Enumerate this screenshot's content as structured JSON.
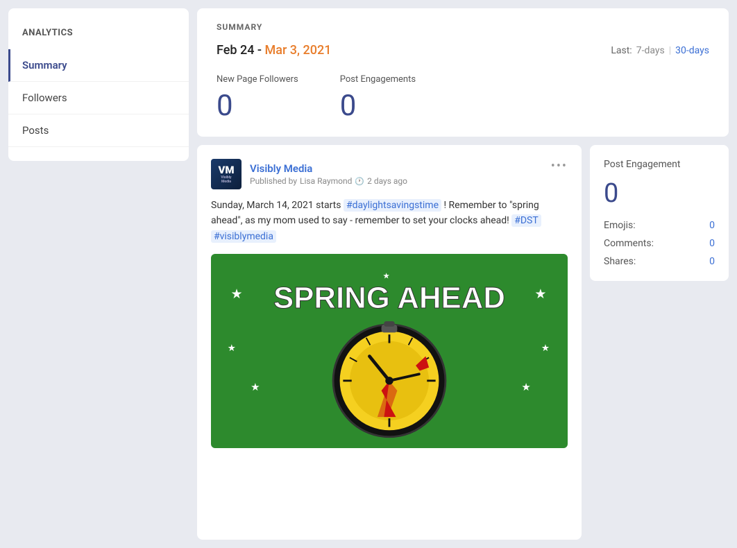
{
  "sidebar": {
    "title": "ANALYTICS",
    "items": [
      {
        "id": "summary",
        "label": "Summary",
        "active": true
      },
      {
        "id": "followers",
        "label": "Followers",
        "active": false
      },
      {
        "id": "posts",
        "label": "Posts",
        "active": false
      }
    ]
  },
  "summary": {
    "section_label": "SUMMARY",
    "date_range_start": "Feb 24 - ",
    "date_range_end": "Mar 3, 2021",
    "last_label": "Last:",
    "period_7": "7-days",
    "period_separator": "|",
    "period_30": "30-days",
    "metrics": [
      {
        "id": "new-page-followers",
        "label": "New Page Followers",
        "value": "0"
      },
      {
        "id": "post-engagements",
        "label": "Post Engagements",
        "value": "0"
      }
    ]
  },
  "post": {
    "author": "Visibly Media",
    "published_prefix": "Published by",
    "publisher": "Lisa Raymond",
    "time_ago": "2 days ago",
    "text_parts": [
      {
        "type": "text",
        "content": "Sunday, March 14, 2021 starts "
      },
      {
        "type": "hashtag",
        "content": "#daylightsavingstime"
      },
      {
        "type": "text",
        "content": " ! Remember to \"spring ahead\", as my mom used to say - remember to set your clocks ahead! "
      },
      {
        "type": "hashtag",
        "content": "#DST"
      },
      {
        "type": "text",
        "content": " "
      },
      {
        "type": "hashtag",
        "content": "#visiblymedia"
      }
    ],
    "image_alt": "Spring Ahead graphic",
    "image_text": "SPRING AHEAD"
  },
  "engagement": {
    "title": "Post Engagement",
    "value": "0",
    "stats": [
      {
        "label": "Emojis:",
        "value": "0"
      },
      {
        "label": "Comments:",
        "value": "0"
      },
      {
        "label": "Shares:",
        "value": "0"
      }
    ]
  }
}
